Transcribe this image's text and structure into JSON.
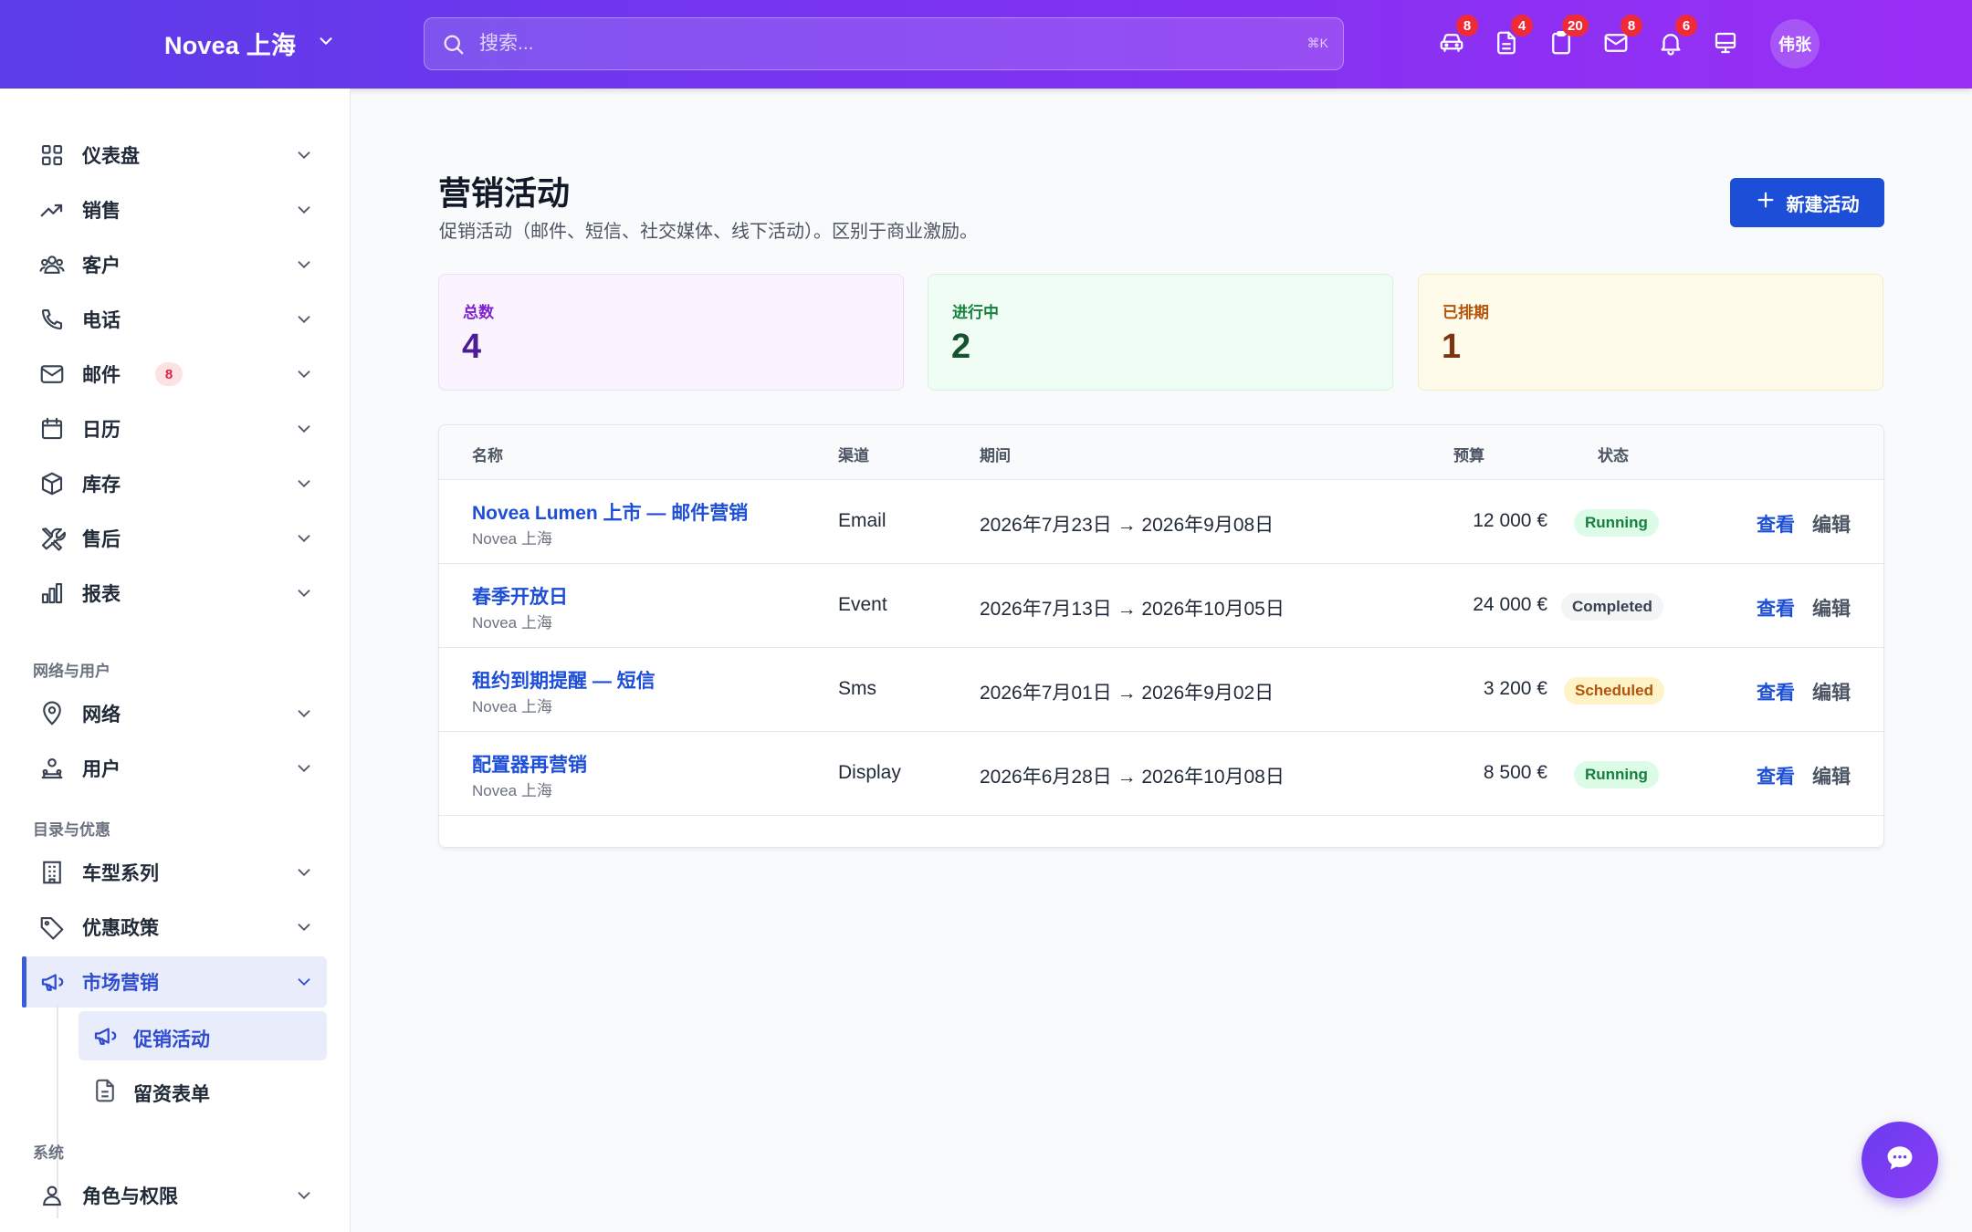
{
  "header": {
    "brand": "Novea 上海",
    "search_placeholder": "搜索...",
    "search_shortcut": "⌘K",
    "badges": {
      "vehicles": "8",
      "documents": "4",
      "tasks": "20",
      "mail": "8",
      "notifications": "6"
    },
    "avatar_initials": "伟张"
  },
  "sidebar": {
    "items": [
      {
        "label": "仪表盘",
        "icon": "grid-icon"
      },
      {
        "label": "销售",
        "icon": "trend-icon"
      },
      {
        "label": "客户",
        "icon": "users-icon"
      },
      {
        "label": "电话",
        "icon": "phone-icon"
      },
      {
        "label": "邮件",
        "icon": "mail-icon",
        "badge": "8"
      },
      {
        "label": "日历",
        "icon": "calendar-icon"
      },
      {
        "label": "库存",
        "icon": "box-icon"
      },
      {
        "label": "售后",
        "icon": "tools-icon"
      },
      {
        "label": "报表",
        "icon": "chart-icon"
      }
    ],
    "section_network": "网络与用户",
    "network_items": [
      {
        "label": "网络"
      },
      {
        "label": "用户"
      }
    ],
    "section_catalog": "目录与优惠",
    "catalog_items": [
      {
        "label": "车型系列"
      },
      {
        "label": "优惠政策"
      },
      {
        "label": "市场营销"
      }
    ],
    "marketing_sub": [
      {
        "label": "促销活动"
      },
      {
        "label": "留资表单"
      }
    ],
    "section_system": "系统",
    "system_items": [
      {
        "label": "角色与权限"
      }
    ]
  },
  "main": {
    "title": "营销活动",
    "subtitle": "促销活动（邮件、短信、社交媒体、线下活动）。区别于商业激励。",
    "new_button": "新建活动",
    "stats": [
      {
        "label": "总数",
        "value": "4"
      },
      {
        "label": "进行中",
        "value": "2"
      },
      {
        "label": "已排期",
        "value": "1"
      }
    ],
    "table": {
      "headers": {
        "name": "名称",
        "channel": "渠道",
        "period": "期间",
        "budget": "预算",
        "status": "状态"
      },
      "rows": [
        {
          "name": "Novea Lumen 上市 — 邮件营销",
          "site": "Novea 上海",
          "channel": "Email",
          "period": "2026年7月23日 → 2026年9月08日",
          "budget": "12 000 €",
          "status": "Running",
          "view": "查看",
          "edit": "编辑"
        },
        {
          "name": "春季开放日",
          "site": "Novea 上海",
          "channel": "Event",
          "period": "2026年7月13日 → 2026年10月05日",
          "budget": "24 000 €",
          "status": "Completed",
          "view": "查看",
          "edit": "编辑"
        },
        {
          "name": "租约到期提醒 — 短信",
          "site": "Novea 上海",
          "channel": "Sms",
          "period": "2026年7月01日 → 2026年9月02日",
          "budget": "3 200 €",
          "status": "Scheduled",
          "view": "查看",
          "edit": "编辑"
        },
        {
          "name": "配置器再营销",
          "site": "Novea 上海",
          "channel": "Display",
          "period": "2026年6月28日 → 2026年10月08日",
          "budget": "8 500 €",
          "status": "Running",
          "view": "查看",
          "edit": "编辑"
        }
      ]
    }
  },
  "colors": {
    "accent": "#1d4ed8",
    "header_start": "#5a3ce8",
    "header_end": "#9a2ef5",
    "badge_red": "#ef2b38",
    "status_running": "#dcfce7",
    "status_completed": "#f3f4f6",
    "status_scheduled": "#fef3c7"
  }
}
